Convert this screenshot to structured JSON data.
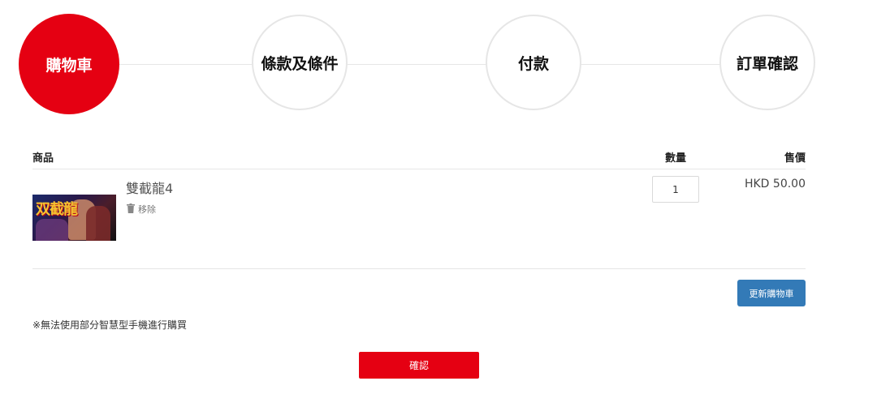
{
  "steps": [
    {
      "label": "購物車",
      "active": true
    },
    {
      "label": "條款及條件",
      "active": false
    },
    {
      "label": "付款",
      "active": false
    },
    {
      "label": "訂單確認",
      "active": false
    }
  ],
  "colors": {
    "accent": "#e50012",
    "update_button": "#337ab7"
  },
  "table": {
    "headers": {
      "product": "商品",
      "quantity": "數量",
      "price": "售價"
    }
  },
  "cart": {
    "items": [
      {
        "name": "雙截龍4",
        "remove_label": "移除",
        "quantity": "1",
        "price": "HKD 50.00",
        "thumbnail_text": "双截龍"
      }
    ]
  },
  "actions": {
    "update_label": "更新購物車",
    "confirm_label": "確認"
  },
  "note": "※無法使用部分智慧型手機進行購買"
}
